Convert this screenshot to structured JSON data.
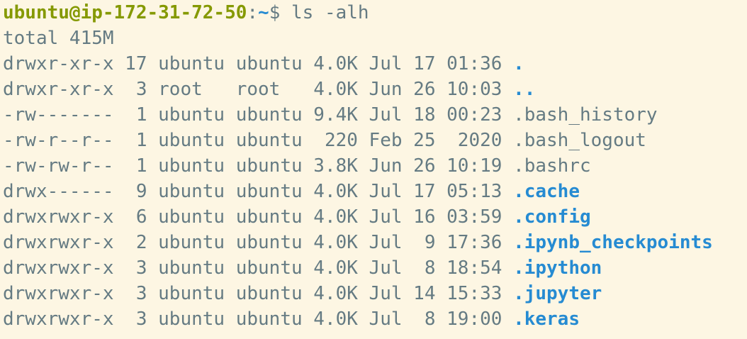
{
  "prompt": {
    "user_host": "ubuntu@ip-172-31-72-50",
    "separator": ":",
    "path": "~",
    "symbol": "$ ",
    "command": "ls -alh"
  },
  "total": "total 415M",
  "entries": [
    {
      "meta": "drwxr-xr-x 17 ubuntu ubuntu 4.0K Jul 17 01:36 ",
      "name": ".",
      "is_dir": true
    },
    {
      "meta": "drwxr-xr-x  3 root   root   4.0K Jun 26 10:03 ",
      "name": "..",
      "is_dir": true
    },
    {
      "meta": "-rw-------  1 ubuntu ubuntu 9.4K Jul 18 00:23 ",
      "name": ".bash_history",
      "is_dir": false
    },
    {
      "meta": "-rw-r--r--  1 ubuntu ubuntu  220 Feb 25  2020 ",
      "name": ".bash_logout",
      "is_dir": false
    },
    {
      "meta": "-rw-rw-r--  1 ubuntu ubuntu 3.8K Jun 26 10:19 ",
      "name": ".bashrc",
      "is_dir": false
    },
    {
      "meta": "drwx------  9 ubuntu ubuntu 4.0K Jul 17 05:13 ",
      "name": ".cache",
      "is_dir": true
    },
    {
      "meta": "drwxrwxr-x  6 ubuntu ubuntu 4.0K Jul 16 03:59 ",
      "name": ".config",
      "is_dir": true
    },
    {
      "meta": "drwxrwxr-x  2 ubuntu ubuntu 4.0K Jul  9 17:36 ",
      "name": ".ipynb_checkpoints",
      "is_dir": true
    },
    {
      "meta": "drwxrwxr-x  3 ubuntu ubuntu 4.0K Jul  8 18:54 ",
      "name": ".ipython",
      "is_dir": true
    },
    {
      "meta": "drwxrwxr-x  3 ubuntu ubuntu 4.0K Jul 14 15:33 ",
      "name": ".jupyter",
      "is_dir": true
    },
    {
      "meta": "drwxrwxr-x  3 ubuntu ubuntu 4.0K Jul  8 19:00 ",
      "name": ".keras",
      "is_dir": true
    }
  ],
  "colors": {
    "background": "#fdf6e3",
    "text": "#657b83",
    "prompt_user": "#859900",
    "directory": "#268bd2"
  }
}
